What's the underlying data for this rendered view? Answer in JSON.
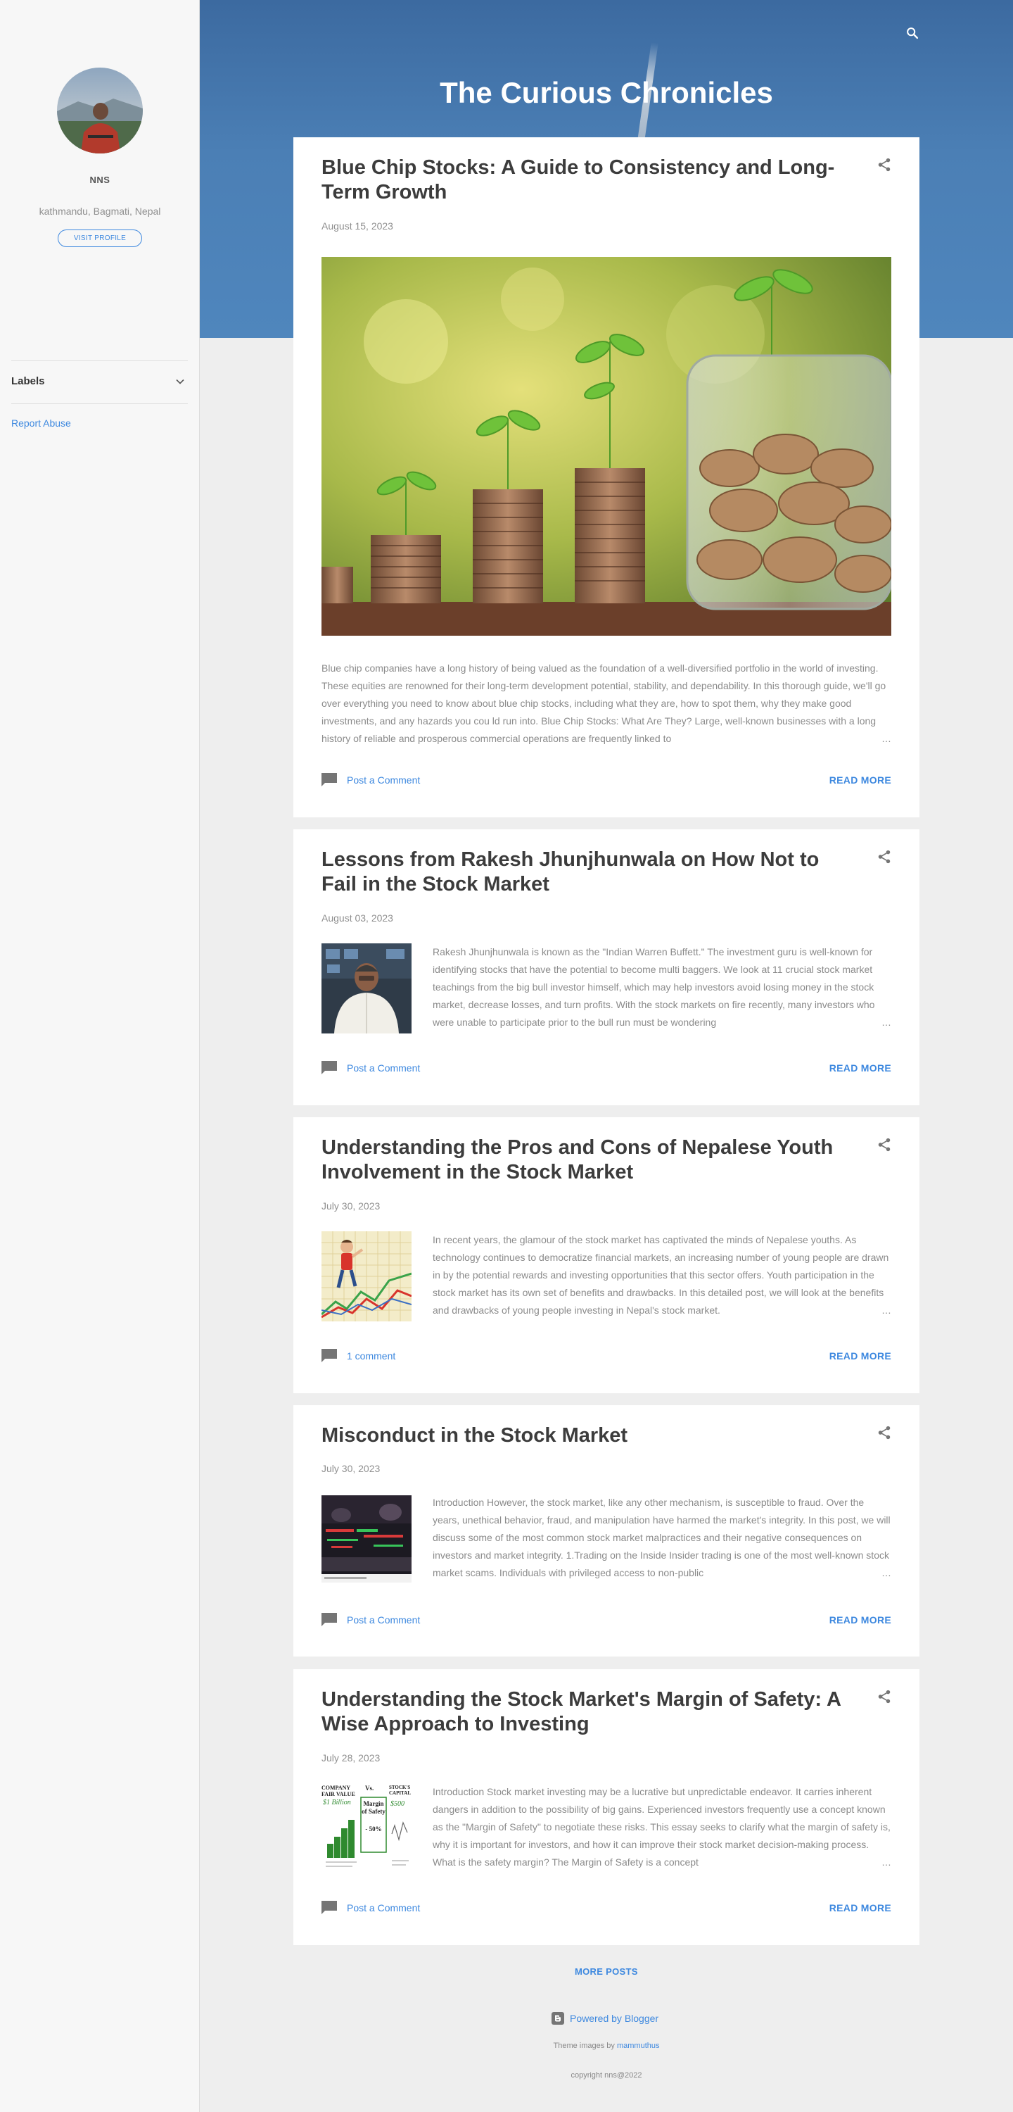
{
  "sidebar": {
    "profile_name": "NNS",
    "location": "kathmandu, Bagmati, Nepal",
    "visit_profile": "VISIT PROFILE",
    "labels": "Labels",
    "report_abuse": "Report Abuse"
  },
  "header": {
    "title": "The Curious Chronicles"
  },
  "posts": [
    {
      "title": "Blue Chip Stocks: A Guide to Consistency and Long-Term Growth",
      "date": "August 15, 2023",
      "snippet": "Blue chip companies have a long history of being valued as the foundation of a well-diversified portfolio in the world of investing. These equities are renowned for their long-term development potential, stability, and dependability. In this thorough guide, we'll go over everything you need to know about blue chip stocks, including what they are, how to spot them, why they make good investments, and any hazards you cou ld run into. Blue Chip Stocks: What Are They? Large, well-known businesses with a long history of reliable and prosperous commercial operations are frequently linked to",
      "comment": "Post a Comment",
      "read_more": "READ MORE"
    },
    {
      "title": "Lessons from Rakesh Jhunjhunwala on How Not to Fail in the Stock Market",
      "date": "August 03, 2023",
      "snippet": "Rakesh Jhunjhunwala is known as the \"Indian Warren Buffett.\" The investment guru is well-known for identifying stocks that have the potential to become multi baggers. We look at 11 crucial stock market teachings from the big bull investor himself, which may help investors avoid losing money in the stock market, decrease losses, and turn profits. With the stock markets on fire recently, many investors who were unable to participate prior to the bull run must be wondering",
      "comment": "Post a Comment",
      "read_more": "READ MORE"
    },
    {
      "title": "Understanding the Pros and Cons of Nepalese Youth Involvement in the Stock Market",
      "date": "July 30, 2023",
      "snippet": "In recent years, the glamour of the stock market has captivated the minds of Nepalese youths. As technology continues to democratize financial markets, an increasing number of young people are drawn in by the potential rewards and investing opportunities that this sector offers. Youth participation in the stock market has its own set of benefits and drawbacks. In this detailed post, we will look at the benefits and drawbacks of young people investing in Nepal's stock market.",
      "comment": "1 comment",
      "read_more": "READ MORE"
    },
    {
      "title": "Misconduct in the Stock Market",
      "date": "July 30, 2023",
      "snippet": "Introduction  However, the stock market, like any other mechanism, is susceptible to fraud. Over the years, unethical behavior, fraud, and manipulation have harmed the market's integrity. In this post, we will discuss some of the most common stock market malpractices and their negative consequences on investors and market integrity. 1.Trading on the Inside Insider trading is one of the most well-known stock market scams. Individuals with privileged access to non-public",
      "comment": "Post a Comment",
      "read_more": "READ MORE"
    },
    {
      "title": "Understanding the Stock Market's Margin of Safety: A Wise Approach to Investing",
      "date": "July 28, 2023",
      "snippet": "Introduction Stock market investing may be a lucrative but unpredictable endeavor. It carries inherent dangers in addition to the possibility of big gains. Experienced investors frequently use a concept known as the \"Margin of Safety\" to negotiate these risks. This essay seeks to clarify what the margin of safety is, why it is important for investors, and how it can improve their stock market decision-making process. What is the safety margin? The Margin of Safety is a concept",
      "comment": "Post a Comment",
      "read_more": "READ MORE"
    }
  ],
  "thumb_text": {
    "company_fair_value": "COMPANY FAIR VALUE",
    "fair_amount": "$1 Billion",
    "vs": "Vs.",
    "margin": "Margin of Safety",
    "margin_pct": "- 50%",
    "stock_cap": "STOCK'S CAPITAL",
    "cap_amount": "$500"
  },
  "footer": {
    "more_posts": "MORE POSTS",
    "powered_by": "Powered by Blogger",
    "theme_prefix": "Theme images by",
    "theme_author": "mammuthus",
    "copyright": "copyright nns@2022"
  },
  "icons": {
    "search": "search-icon",
    "share": "share-icon",
    "comment": "comment-icon",
    "chevron": "chevron-down-icon",
    "blogger": "blogger-icon"
  },
  "colors": {
    "accent": "#3d88df",
    "header_blue": "#4b7fb5",
    "background": "#eeeeee"
  }
}
